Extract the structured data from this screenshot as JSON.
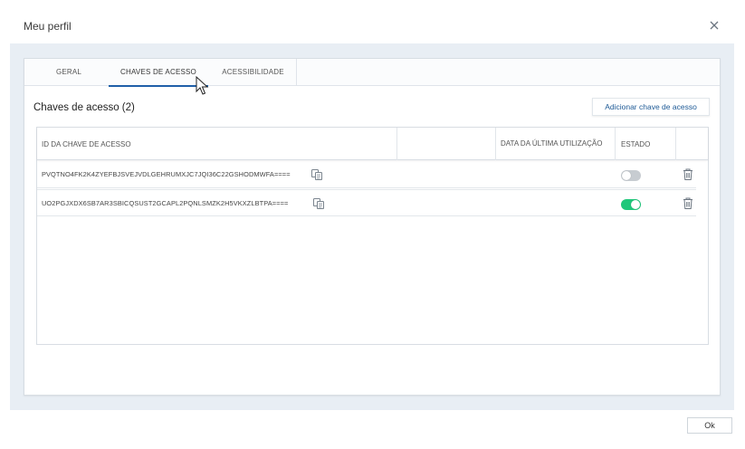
{
  "dialog": {
    "title": "Meu perfil"
  },
  "tabs": [
    {
      "label": "GERAL"
    },
    {
      "label": "CHAVES DE ACESSO"
    },
    {
      "label": "ACESSIBILIDADE"
    }
  ],
  "section": {
    "title": "Chaves de acesso (2)",
    "add_button": "Adicionar chave de acesso"
  },
  "table": {
    "headers": [
      "ID DA CHAVE DE ACESSO",
      "DATA DA ÚLTIMA UTILIZAÇÃO",
      "ESTADO"
    ],
    "rows": [
      {
        "key_id": "PVQTNO4FK2K4ZYEFBJSVEJVDLGEHRUMXJC7JQI36C22GSHODMWFA====",
        "last_used": "",
        "enabled": false
      },
      {
        "key_id": "UO2PGJXDX6SB7AR3SBICQSUST2GCAPL2PQNLSMZK2H5VKXZLBTPA====",
        "last_used": "",
        "enabled": true
      }
    ]
  },
  "footer": {
    "ok_label": "Ok"
  },
  "colors": {
    "accent": "#1f5fa8",
    "toggle_on": "#1ec77a",
    "toggle_off": "#c7ccd1"
  },
  "icons": [
    "close-icon",
    "copy-icon",
    "trash-icon",
    "mouse-cursor-icon"
  ]
}
